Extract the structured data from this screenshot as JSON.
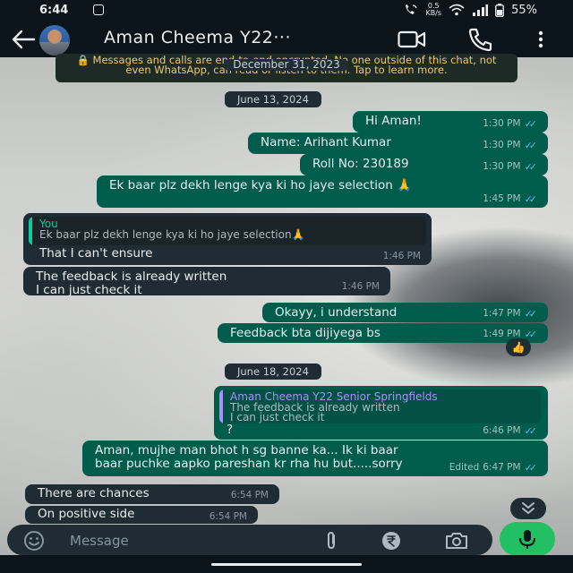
{
  "status_bar": {
    "time": "6:44",
    "network_speed_value": "0.5",
    "network_speed_unit": "KB/s",
    "battery": "55%"
  },
  "header": {
    "contact_name": "Aman Cheema Y22···"
  },
  "encryption_notice": {
    "text": "🔒 Messages and calls are end-to-end encrypted. No one outside of this chat, not even WhatsApp, can read or listen to them. Tap to learn more.",
    "sticky_date": "December 31, 2023"
  },
  "dates": [
    "June 13, 2024",
    "June 18, 2024"
  ],
  "messages": [
    {
      "text": "Hi Aman!",
      "time": "1:30 PM",
      "ticks": "✓✓"
    },
    {
      "text": "Name: Arihant Kumar",
      "time": "1:30 PM",
      "ticks": "✓✓"
    },
    {
      "text": "Roll No: 230189",
      "time": "1:30 PM",
      "ticks": "✓✓"
    },
    {
      "text": "Ek baar plz dekh lenge kya ki ho jaye selection 🙏",
      "time": "1:45 PM",
      "ticks": "✓✓"
    },
    {
      "quote_author": "You",
      "quote_text": "Ek baar plz dekh lenge kya ki ho jaye selection🙏",
      "text": "That I can't ensure",
      "time": "1:46 PM"
    },
    {
      "line1": "The feedback is already written",
      "line2": "I can just check it",
      "time": "1:46 PM"
    },
    {
      "text": "Okayy, i understand",
      "time": "1:47 PM",
      "ticks": "✓✓"
    },
    {
      "text": "Feedback bta dijiyega bs",
      "time": "1:49 PM",
      "ticks": "✓✓",
      "reaction": "👍"
    },
    {
      "quote_author": "Aman Cheema Y22 Senior Springfields",
      "quote_line1": "The feedback is already written",
      "quote_line2": "I can just check it",
      "text": "?",
      "time": "6:46 PM",
      "ticks": "✓✓"
    },
    {
      "line1": "Aman, mujhe man bhot h sg banne ka... Ik ki baar",
      "line2": "baar puchke aapko pareshan kr rha hu but.....sorry",
      "edited": "Edited",
      "time": "6:47 PM",
      "ticks": "✓✓"
    },
    {
      "text": "There are chances",
      "time": "6:54 PM"
    },
    {
      "text": "On positive side",
      "time": "6:54 PM"
    }
  ],
  "input": {
    "placeholder": "Message"
  },
  "colors": {
    "outgoing_bubble": "#005c4b",
    "incoming_bubble": "#202c33",
    "tick_blue": "#53bdeb",
    "mic_green": "#21c063",
    "notice_yellow": "#f1c868"
  },
  "icons": [
    "back-arrow-icon",
    "video-camera-icon",
    "phone-icon",
    "more-vert-icon",
    "emoji-icon",
    "paperclip-icon",
    "rupee-icon",
    "camera-icon",
    "mic-icon",
    "chevron-down-icon"
  ]
}
